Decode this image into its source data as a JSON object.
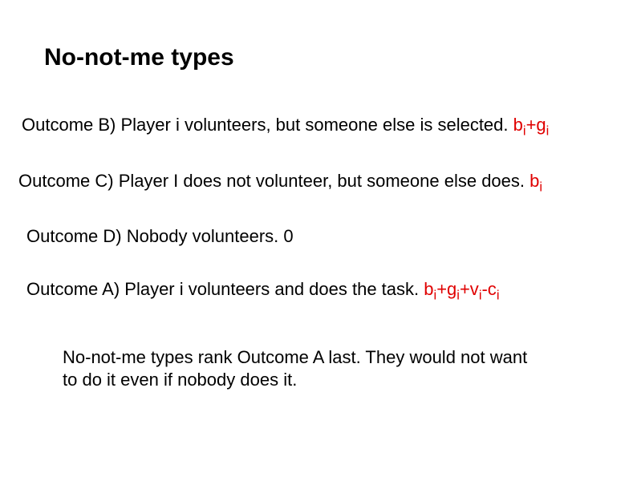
{
  "title": "No-not-me types",
  "outcomes": {
    "B": {
      "prefix": "Outcome B)  Player i  volunteers, but someone else is selected. ",
      "payoff_parts": [
        "b",
        "i",
        "+g",
        "i"
      ]
    },
    "C": {
      "prefix": "Outcome C) Player I does not volunteer, but someone else does.  ",
      "payoff_parts": [
        "b",
        "i"
      ]
    },
    "D": {
      "text": "Outcome D) Nobody volunteers.   0"
    },
    "A": {
      "prefix": "Outcome A)   Player i volunteers and does the task.  ",
      "payoff_parts": [
        "b",
        "i",
        "+g",
        "i",
        "+v",
        "i",
        "-c",
        "i"
      ]
    }
  },
  "summary": "No-not-me types rank Outcome A last.  They would not want to do it even if nobody does it."
}
